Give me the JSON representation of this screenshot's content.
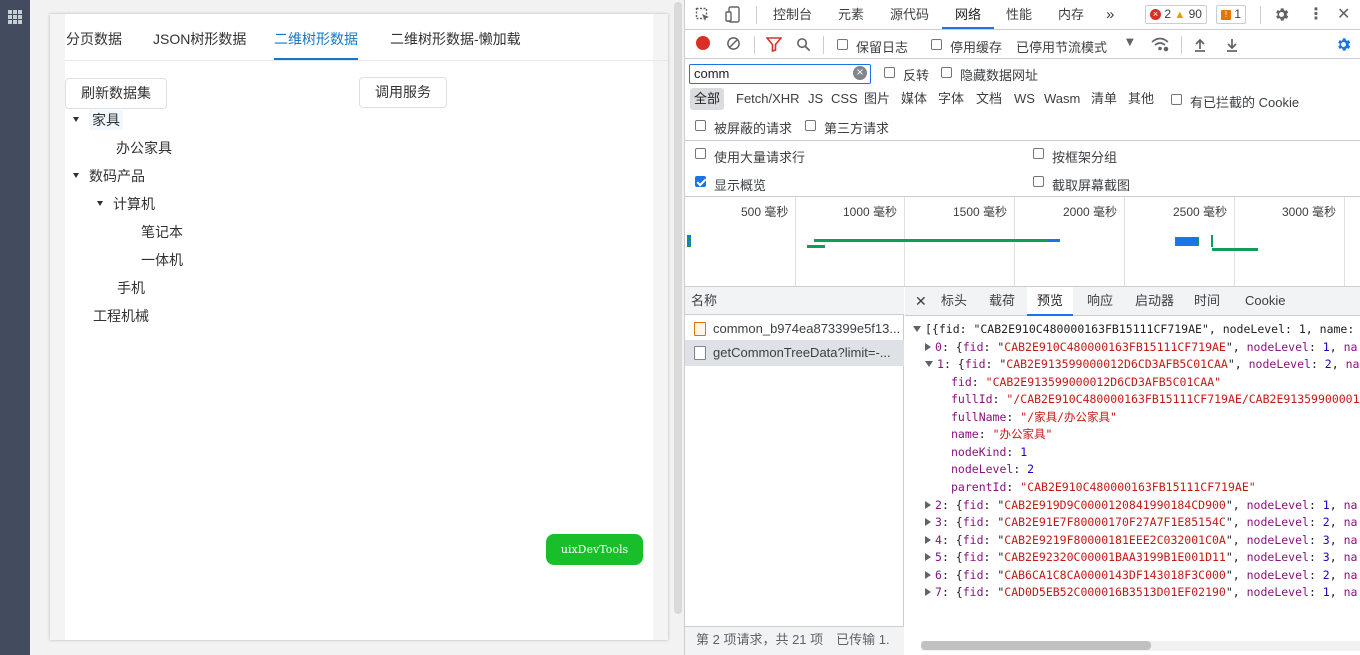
{
  "app": {
    "tabs": [
      "分页数据",
      "JSON树形数据",
      "二维树形数据",
      "二维树形数据-懒加载"
    ],
    "active_tab": "二维树形数据",
    "refresh_button": "刷新数据集",
    "invoke_button": "调用服务",
    "tree": [
      {
        "label": "家具",
        "level": 0,
        "expanded": true,
        "selected": true
      },
      {
        "label": "办公家具",
        "level": 1,
        "expanded": null
      },
      {
        "label": "数码产品",
        "level": 0,
        "expanded": true
      },
      {
        "label": "计算机",
        "level": 1,
        "expanded": true
      },
      {
        "label": "笔记本",
        "level": 2,
        "expanded": null
      },
      {
        "label": "一体机",
        "level": 2,
        "expanded": null
      },
      {
        "label": "手机",
        "level": 1,
        "expanded": null
      },
      {
        "label": "工程机械",
        "level": 0,
        "expanded": null
      }
    ],
    "dev_tools_button": "uixDevTools"
  },
  "devtools": {
    "tabs": [
      "控制台",
      "元素",
      "源代码",
      "网络",
      "性能",
      "内存"
    ],
    "active_tab": "网络",
    "more_tabs": "»",
    "errors": "2",
    "warnings": "90",
    "issues": "1",
    "toolbar": {
      "preserve_log": "保留日志",
      "disable_cache": "停用缓存",
      "throttling": "已停用节流模式"
    },
    "filter": {
      "value": "comm",
      "invert": "反转",
      "hide_data_urls": "隐藏数据网址"
    },
    "types": [
      "全部",
      "Fetch/XHR",
      "JS",
      "CSS",
      "图片",
      "媒体",
      "字体",
      "文档",
      "WS",
      "Wasm",
      "清单",
      "其他"
    ],
    "active_type": "全部",
    "blocked_cookies": "有已拦截的 Cookie",
    "blocked_requests": "被屏蔽的请求",
    "third_party": "第三方请求",
    "large_rows": "使用大量请求行",
    "group_by_frame": "按框架分组",
    "show_overview": "显示概览",
    "capture_screenshots": "截取屏幕截图",
    "overview_ticks": [
      "500 毫秒",
      "1000 毫秒",
      "1500 毫秒",
      "2000 毫秒",
      "2500 毫秒",
      "3000 毫秒"
    ],
    "name_header": "名称",
    "requests": [
      {
        "name": "common_b974ea873399e5f13...",
        "type": "script"
      },
      {
        "name": "getCommonTreeData?limit=-...",
        "type": "xhr",
        "selected": true
      }
    ],
    "status_bar": "第 2 项请求，共 21 项　已传输 1.",
    "detail_tabs": [
      "标头",
      "载荷",
      "预览",
      "响应",
      "启动器",
      "时间",
      "Cookie"
    ],
    "active_detail_tab": "预览",
    "preview": {
      "root": "[{fid: \"CAB2E910C480000163FB15111CF719AE\", nodeLevel: 1, name:",
      "rows": [
        {
          "index": "0",
          "fid": "CAB2E910C480000163FB15111CF719AE",
          "nodeLevel": "1",
          "tail": "na"
        },
        {
          "index": "1",
          "fid": "CAB2E913599000012D6CD3AFB5C01CAA",
          "nodeLevel": "2",
          "tail": "na"
        },
        {
          "index": "2",
          "fid": "CAB2E919D9C0000120841990184CD900",
          "nodeLevel": "1",
          "tail": "na"
        },
        {
          "index": "3",
          "fid": "CAB2E91E7F80000170F27A7F1E85154C",
          "nodeLevel": "2",
          "tail": "na"
        },
        {
          "index": "4",
          "fid": "CAB2E9219F80000181EEE2C032001C0A",
          "nodeLevel": "3",
          "tail": "na"
        },
        {
          "index": "5",
          "fid": "CAB2E92320C00001BAA3199B1E001D11",
          "nodeLevel": "3",
          "tail": "na"
        },
        {
          "index": "6",
          "fid": "CAB6CA1C8CA0000143DF143018F3C000",
          "nodeLevel": "2",
          "tail": "na"
        },
        {
          "index": "7",
          "fid": "CAD0D5EB52C000016B3513D01EF02190",
          "nodeLevel": "1",
          "tail": "na"
        }
      ],
      "expanded": {
        "fid": "CAB2E913599000012D6CD3AFB5C01CAA",
        "fullId": "/CAB2E910C480000163FB15111CF719AE/CAB2E91359900001",
        "fullName": "/家具/办公家具",
        "name": "办公家具",
        "nodeKind": "1",
        "nodeLevel": "2",
        "parentId": "CAB2E910C480000163FB15111CF719AE"
      }
    }
  },
  "colors": {
    "accent": "#1677c8",
    "devtools_accent": "#1a73e8",
    "uix_button": "#19be2b",
    "record": "#d93025",
    "filter_icon": "#d93025"
  }
}
